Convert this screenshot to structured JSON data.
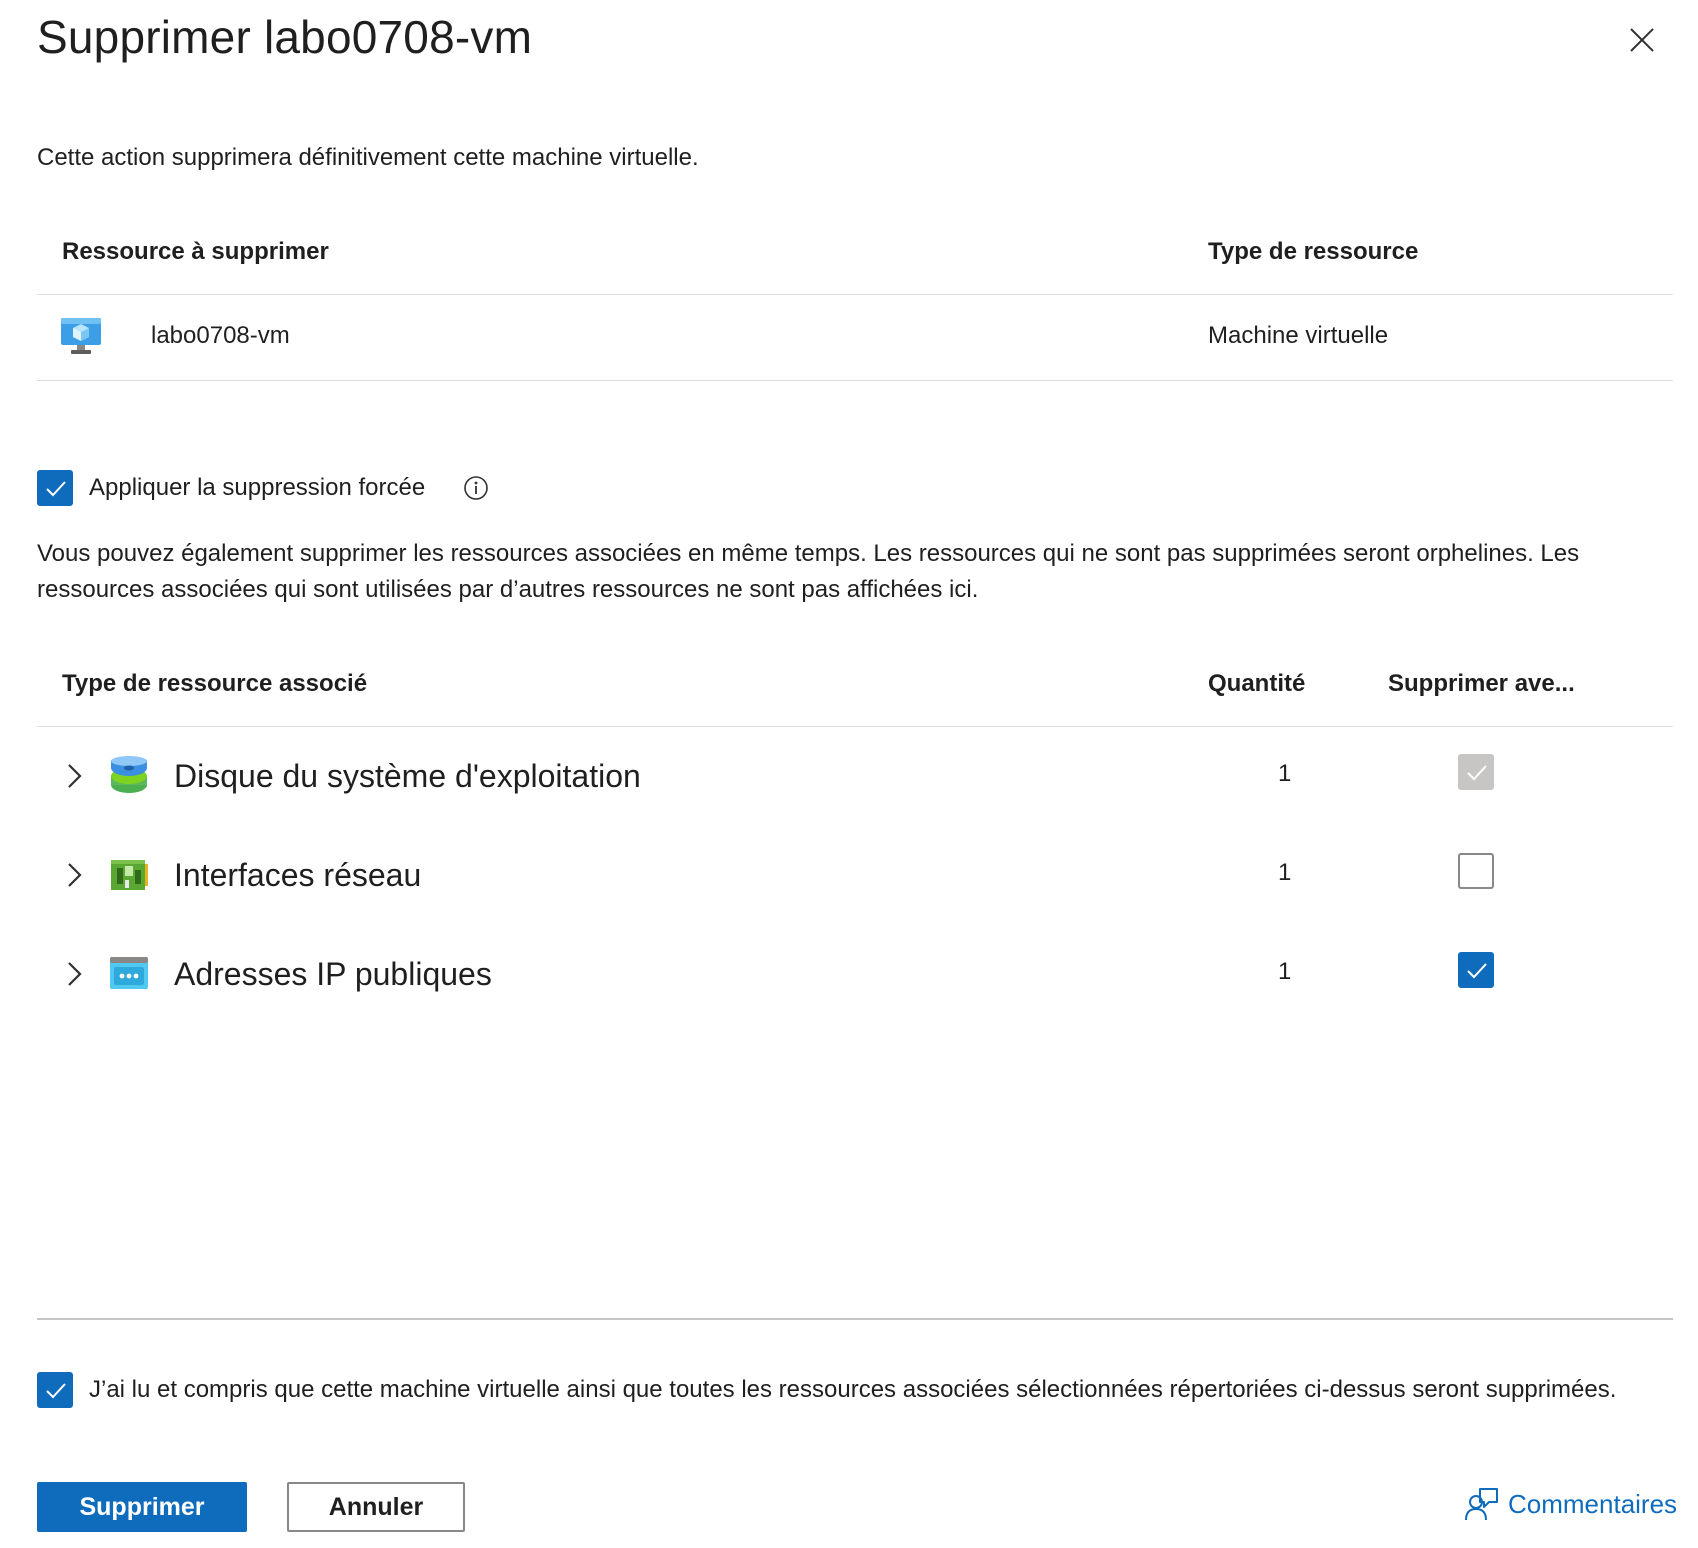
{
  "dialog": {
    "title": "Supprimer labo0708-vm",
    "description": "Cette action supprimera définitivement cette machine virtuelle."
  },
  "resource_table": {
    "headers": [
      "Ressource à supprimer",
      "Type de ressource"
    ],
    "row": {
      "icon": "virtual-machine-icon",
      "name": "labo0708-vm",
      "type": "Machine virtuelle"
    }
  },
  "force_delete": {
    "label": "Appliquer la suppression forcée",
    "checked": true,
    "info_icon": "info-icon"
  },
  "associated_text": "Vous pouvez également supprimer les ressources associées en même temps. Les ressources qui ne sont pas supprimées seront orphelines. Les ressources associées qui sont utilisées par d’autres ressources ne sont pas affichées ici.",
  "associated_table": {
    "headers": [
      "Type de ressource associé",
      "Quantité",
      "Supprimer ave..."
    ],
    "rows": [
      {
        "name": "Disque du système d'exploitation",
        "icon": "disk-icon",
        "quantity": "1",
        "state": "checked-disabled"
      },
      {
        "name": "Interfaces réseau",
        "icon": "network-interface-icon",
        "quantity": "1",
        "state": "unchecked"
      },
      {
        "name": "Adresses IP publiques",
        "icon": "public-ip-icon",
        "quantity": "1",
        "state": "checked"
      }
    ]
  },
  "acknowledge": {
    "text": "J’ai lu et compris que cette machine virtuelle ainsi que toutes les ressources associées sélectionnées répertoriées ci-dessus seront supprimées.",
    "checked": true
  },
  "buttons": {
    "delete": "Supprimer",
    "cancel": "Annuler"
  },
  "feedback": {
    "label": "Commentaires",
    "icon": "feedback-icon"
  },
  "colors": {
    "accent": "#0f6cbd",
    "disabled": "#c8c6c4",
    "divider": "#e1dfdd"
  }
}
